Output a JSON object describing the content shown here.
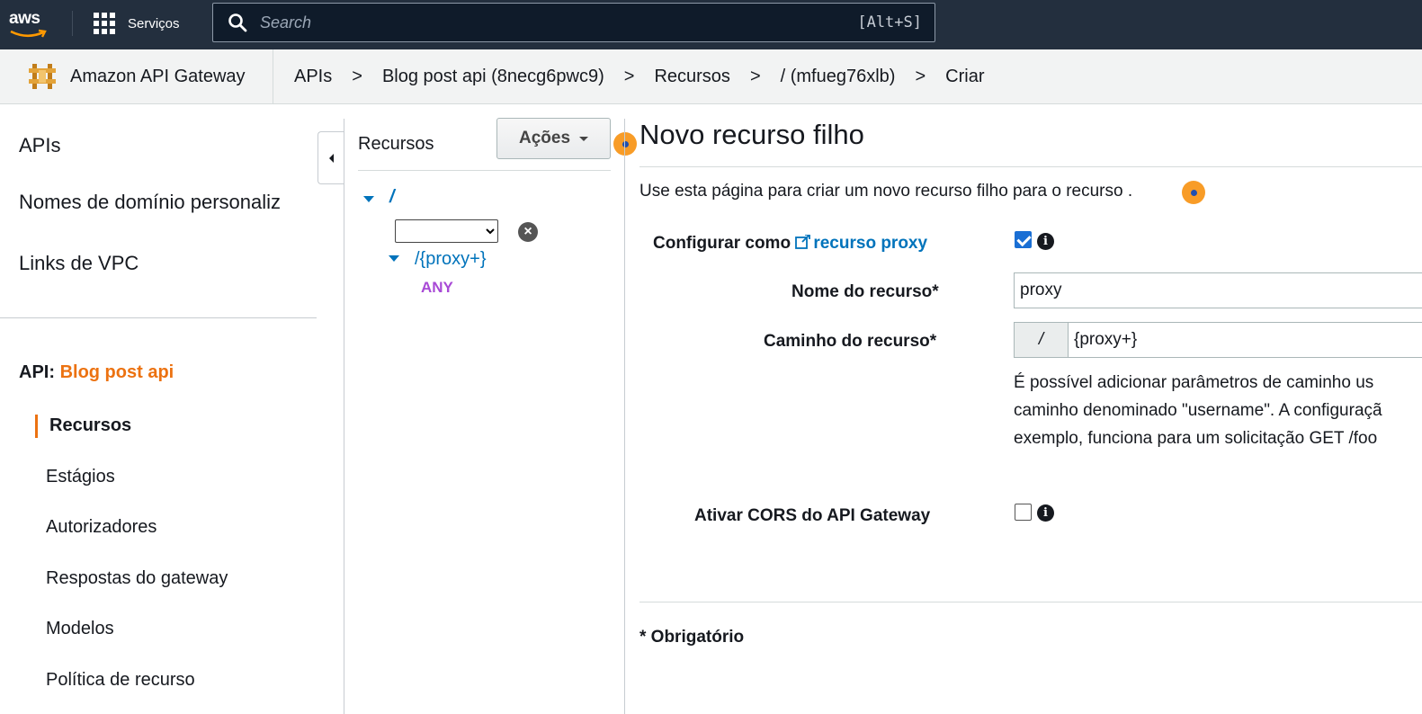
{
  "topnav": {
    "logo_text": "aws",
    "services_label": "Serviços",
    "search_placeholder": "Search",
    "search_shortcut": "[Alt+S]"
  },
  "breadcrumb": {
    "service_name": "Amazon API Gateway",
    "items": [
      "APIs",
      "Blog post api (8necg6pwc9)",
      "Recursos",
      "/ (mfueg76xlb)",
      "Criar"
    ],
    "separator": ">"
  },
  "sidebar": {
    "top_items": [
      "APIs",
      "Nomes de domínio personaliz",
      "Links de VPC"
    ],
    "api_prefix": "API:",
    "api_name": "Blog post api",
    "sub_items": [
      "Recursos",
      "Estágios",
      "Autorizadores",
      "Respostas do gateway",
      "Modelos",
      "Política de recurso"
    ],
    "active": "Recursos"
  },
  "resources": {
    "title": "Recursos",
    "actions_label": "Ações",
    "root": "/",
    "select_value": "",
    "child": "/{proxy+}",
    "method": "ANY"
  },
  "main": {
    "title": "Novo recurso filho",
    "description": "Use esta página para criar um novo recurso filho para o recurso .",
    "proxy_label_prefix": "Configurar como ",
    "proxy_link": "recurso proxy",
    "proxy_checked": true,
    "name_label": "Nome do recurso*",
    "name_value": "proxy",
    "path_label": "Caminho do recurso*",
    "path_prefix": "/",
    "path_value": "{proxy+}",
    "help_lines": [
      "É possível adicionar parâmetros de caminho us",
      "caminho denominado \"username\". A configuraçã",
      "exemplo, funciona para um solicitação GET /foo"
    ],
    "cors_label": "Ativar CORS do API Gateway",
    "cors_checked": false,
    "required_note": "* Obrigatório",
    "info_glyph": "i"
  },
  "colors": {
    "nav_bg": "#232f3e",
    "accent_orange": "#ec7211",
    "link_blue": "#0073bb",
    "method_purple": "#a849d6"
  }
}
